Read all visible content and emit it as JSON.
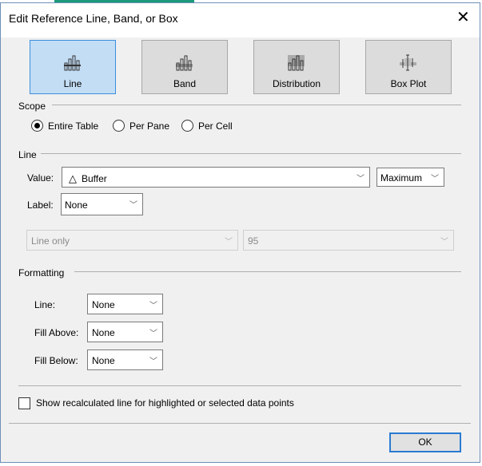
{
  "title": "Edit Reference Line, Band, or Box",
  "types": [
    {
      "label": "Line",
      "selected": true
    },
    {
      "label": "Band",
      "selected": false
    },
    {
      "label": "Distribution",
      "selected": false
    },
    {
      "label": "Box Plot",
      "selected": false
    }
  ],
  "scope": {
    "heading": "Scope",
    "options": [
      "Entire Table",
      "Per Pane",
      "Per Cell"
    ],
    "selected": "Entire Table"
  },
  "line": {
    "heading": "Line",
    "value_label": "Value:",
    "value_icon": "delta-icon",
    "value": "Buffer",
    "aggregation": "Maximum",
    "label_label": "Label:",
    "label_value": "None",
    "line_type": "Line only",
    "confidence": "95"
  },
  "formatting": {
    "heading": "Formatting",
    "line_label": "Line:",
    "line_value": "None",
    "fill_above_label": "Fill Above:",
    "fill_above_value": "None",
    "fill_below_label": "Fill Below:",
    "fill_below_value": "None"
  },
  "recalc_checkbox": {
    "label": "Show recalculated line for highlighted or selected data points",
    "checked": false
  },
  "ok_label": "OK"
}
